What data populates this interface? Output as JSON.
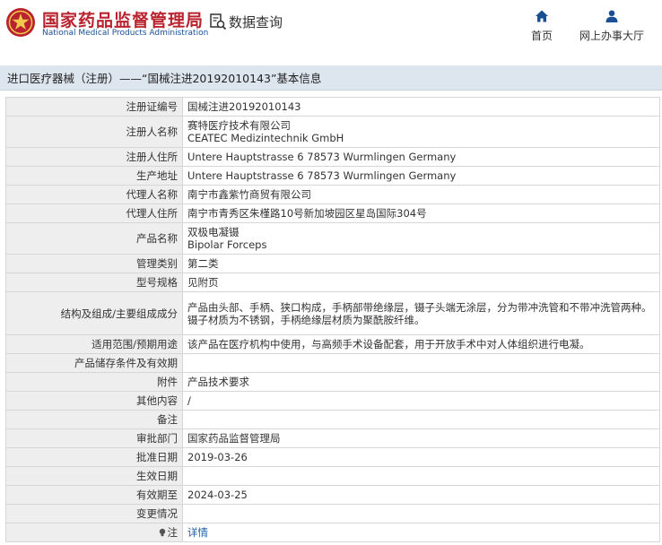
{
  "header": {
    "logo_cn": "国家药品监督管理局",
    "logo_en": "National Medical Products Administration",
    "data_query": "数据查询",
    "nav": [
      {
        "label": "首页",
        "icon": "home-icon"
      },
      {
        "label": "网上办事大厅",
        "icon": "user-icon"
      }
    ]
  },
  "title": "进口医疗器械（注册）——“国械注进20192010143”基本信息",
  "colors": {
    "brand_red": "#b8232f",
    "brand_blue": "#1a4f93",
    "title_bar": "#dde6ef",
    "label_bg": "#eeeeee",
    "link": "#1c5aa5"
  },
  "rows": [
    {
      "label": "注册证编号",
      "value": "国械注进20192010143"
    },
    {
      "label": "注册人名称",
      "value": "赛特医疗技术有限公司",
      "value2": "CEATEC Medizintechnik GmbH"
    },
    {
      "label": "注册人住所",
      "value": "Untere Hauptstrasse 6 78573 Wurmlingen Germany"
    },
    {
      "label": "生产地址",
      "value": "Untere Hauptstrasse 6 78573 Wurmlingen Germany"
    },
    {
      "label": "代理人名称",
      "value": "南宁市鑫紫竹商贸有限公司"
    },
    {
      "label": "代理人住所",
      "value": "南宁市青秀区朱槿路10号新加坡园区星岛国际304号"
    },
    {
      "label": "产品名称",
      "value": "双极电凝镊",
      "value2": "Bipolar Forceps"
    },
    {
      "label": "管理类别",
      "value": "第二类"
    },
    {
      "label": "型号规格",
      "value": "见附页"
    },
    {
      "label": "结构及组成/主要组成成分",
      "value": "产品由头部、手柄、狭口构成，手柄部带绝缘层，镊子头端无涂层，分为带冲洗管和不带冲洗管两种。",
      "value2": "镊子材质为不锈钢，手柄绝缘层材质为聚酰胺纤维。"
    },
    {
      "label": "适用范围/预期用途",
      "value": "该产品在医疗机构中使用，与高频手术设备配套，用于开放手术中对人体组织进行电凝。"
    },
    {
      "label": "产品储存条件及有效期",
      "value": ""
    },
    {
      "label": "附件",
      "value": "产品技术要求"
    },
    {
      "label": "其他内容",
      "value": "/"
    },
    {
      "label": "备注",
      "value": ""
    },
    {
      "label": "审批部门",
      "value": "国家药品监督管理局"
    },
    {
      "label": "批准日期",
      "value": "2019-03-26"
    },
    {
      "label": "生效日期",
      "value": ""
    },
    {
      "label": "有效期至",
      "value": "2024-03-25"
    },
    {
      "label": "变更情况",
      "value": ""
    },
    {
      "label": "注",
      "value": "详情",
      "icon": "bulb-icon"
    }
  ]
}
